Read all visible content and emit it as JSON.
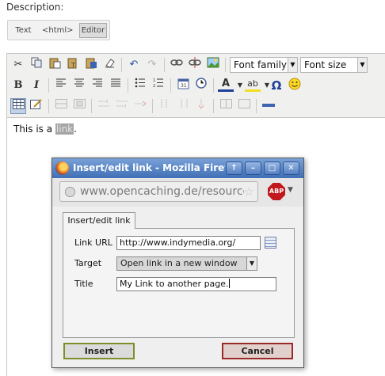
{
  "page": {
    "description_label": "Description:",
    "mode_buttons": [
      "Text",
      "<html>",
      "Editor"
    ],
    "active_mode": "Editor"
  },
  "toolbar": {
    "font_family": "Font family",
    "font_size": "Font size",
    "icons": [
      "cut-icon",
      "copy-icon",
      "paste-icon",
      "paste-text-icon",
      "paste-word-icon",
      "cleanup-icon",
      "undo-icon",
      "redo-icon",
      "link-icon",
      "unlink-icon",
      "image-icon",
      "bold-icon",
      "italic-icon",
      "align-left-icon",
      "align-center-icon",
      "align-right-icon",
      "align-justify-icon",
      "bullet-list-icon",
      "numbered-list-icon",
      "insert-date-icon",
      "insert-time-icon",
      "text-color-icon",
      "highlight-color-icon",
      "special-char-icon",
      "emoticon-icon",
      "table-icon",
      "table-props-icon",
      "horizontal-rule-icon"
    ],
    "glyphs": {
      "bold": "B",
      "italic": "I",
      "special_char": "Ω",
      "emoticon": "☺",
      "text_color": "A",
      "highlight": "ab",
      "undo": "↶",
      "redo": "↷",
      "cut": "✂"
    }
  },
  "content": {
    "text_before": "This is a ",
    "link_text": "link",
    "text_after": "."
  },
  "dialog": {
    "window_title": "Insert/edit link - Mozilla Firefox",
    "url": "www.opencaching.de/resource",
    "tab_label": "Insert/edit link",
    "link_url_label": "Link URL",
    "link_url_value": "http://www.indymedia.org/",
    "target_label": "Target",
    "target_value": "Open link in a new window",
    "title_label": "Title",
    "title_value": "My Link to another page.",
    "insert_label": "Insert",
    "cancel_label": "Cancel",
    "abp_label": "ABP"
  },
  "colors": {
    "titlebar": "#4f7fc0",
    "insert_border": "#7d8f2a",
    "cancel_border": "#9a2a28",
    "link_highlight": "#a5a5a5"
  }
}
